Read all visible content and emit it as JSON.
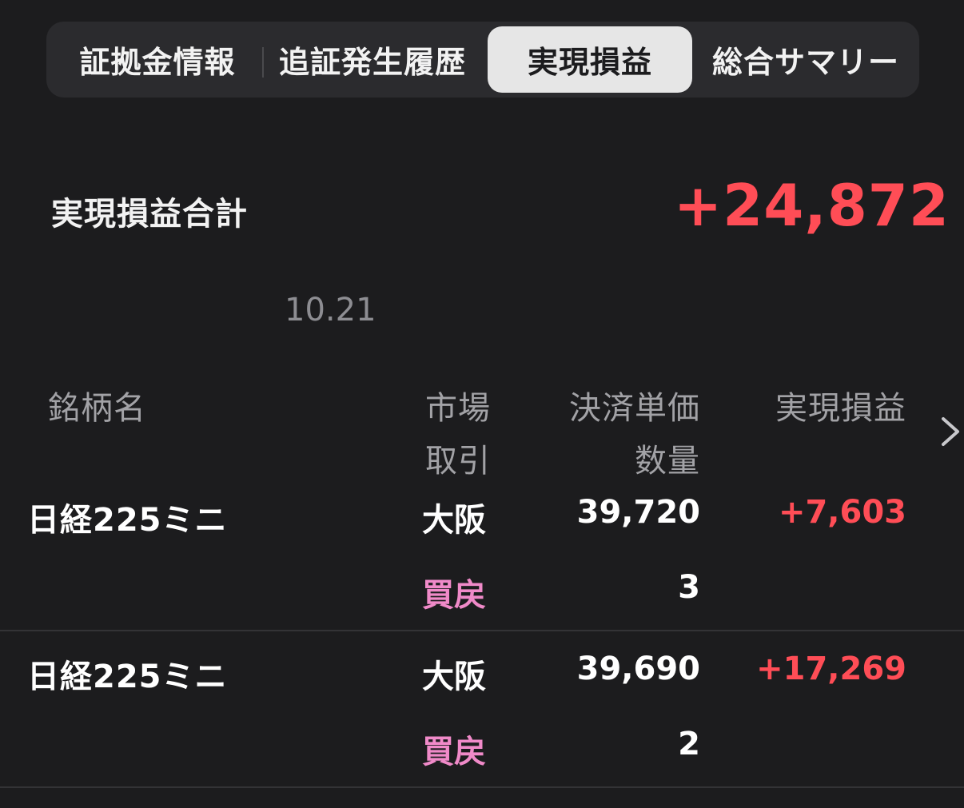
{
  "tabs": [
    {
      "label": "証拠金情報",
      "active": false
    },
    {
      "label": "追証発生履歴",
      "active": false
    },
    {
      "label": "実現損益",
      "active": true
    },
    {
      "label": "総合サマリー",
      "active": false
    }
  ],
  "summary": {
    "label": "実現損益合計",
    "value": "+24,872"
  },
  "date": "10.21",
  "table": {
    "headers": {
      "name": "銘柄名",
      "market": "市場",
      "trade": "取引",
      "price": "決済単価",
      "quantity": "数量",
      "pl": "実現損益"
    },
    "rows": [
      {
        "name": "日経225ミニ",
        "market": "大阪",
        "trade": "買戻",
        "price": "39,720",
        "quantity": "3",
        "pl": "+7,603"
      },
      {
        "name": "日経225ミニ",
        "market": "大阪",
        "trade": "買戻",
        "price": "39,690",
        "quantity": "2",
        "pl": "+17,269"
      }
    ]
  },
  "colors": {
    "background": "#1c1c1e",
    "profit": "#ff4d56",
    "trade_type": "#f08ac9",
    "active_tab": "#e6e6e6"
  },
  "icons": {
    "scroll_right": "chevron-right-icon"
  }
}
